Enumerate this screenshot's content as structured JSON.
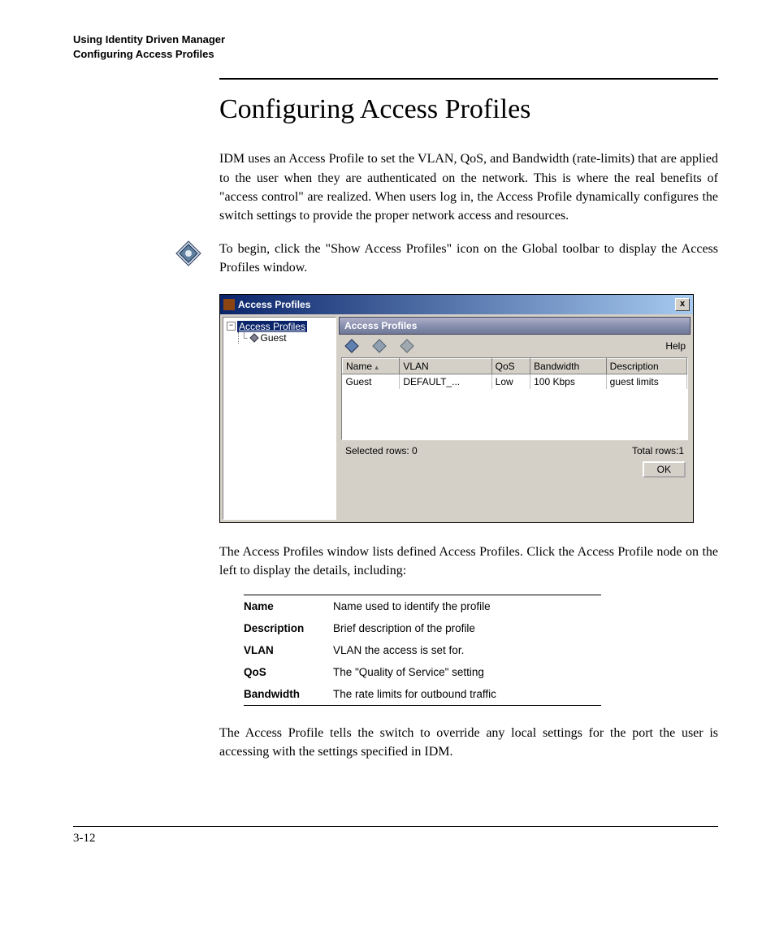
{
  "header": {
    "line1": "Using Identity Driven Manager",
    "line2": "Configuring Access Profiles"
  },
  "title": "Configuring Access Profiles",
  "para1": "IDM uses an Access Profile to set the VLAN, QoS, and Bandwidth (rate-limits) that are applied to the user when they are authenticated on the network. This is where the real benefits of \"access control\" are realized. When users log in, the Access Profile dynamically configures the switch settings to provide the proper network access and resources.",
  "para2": "To begin, click the \"Show Access Profiles\" icon on the Global toolbar to display the Access Profiles window.",
  "para3": "The Access Profiles window lists defined Access Profiles. Click the Access Profile node on the left to display the details, including:",
  "para4": "The Access Profile tells the switch to override any local settings for the port the user is accessing with the settings specified in IDM.",
  "window": {
    "title": "Access Profiles",
    "close": "x",
    "tree": {
      "root": "Access Profiles",
      "child": "Guest",
      "expander": "−"
    },
    "pane_title": "Access Profiles",
    "help": "Help",
    "columns": {
      "name": "Name",
      "sort": "▴",
      "vlan": "VLAN",
      "qos": "QoS",
      "bandwidth": "Bandwidth",
      "description": "Description"
    },
    "row": {
      "name": "Guest",
      "vlan": "DEFAULT_...",
      "qos": "Low",
      "bandwidth": "100 Kbps",
      "description": "guest limits"
    },
    "selected": "Selected rows: 0",
    "total": "Total rows:1",
    "ok": "OK"
  },
  "defs": [
    {
      "term": "Name",
      "desc": "Name used to identify the profile"
    },
    {
      "term": "Description",
      "desc": "Brief description of the profile"
    },
    {
      "term": "VLAN",
      "desc": "VLAN the access is set for."
    },
    {
      "term": "QoS",
      "desc": "The \"Quality of Service\" setting"
    },
    {
      "term": "Bandwidth",
      "desc": "The rate limits for outbound traffic"
    }
  ],
  "page_number": "3-12"
}
